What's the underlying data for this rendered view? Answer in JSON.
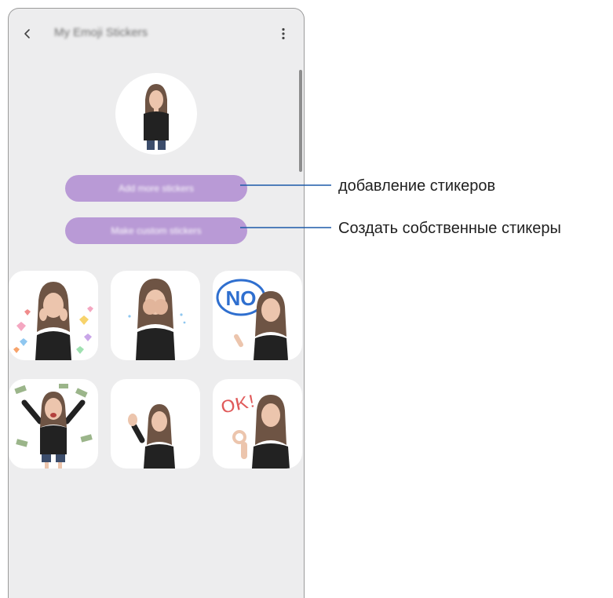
{
  "app": {
    "title": "My Emoji Stickers",
    "back_icon": "chevron-left-icon",
    "more_icon": "more-vertical-icon"
  },
  "buttons": {
    "add_label": "Add more stickers",
    "custom_label": "Make custom stickers",
    "color": "#b99ad6"
  },
  "stickers": [
    {
      "name": "hearts-surprised"
    },
    {
      "name": "face-palm"
    },
    {
      "name": "no-speech-bubble",
      "text": "NO"
    },
    {
      "name": "money-rain-celebrate"
    },
    {
      "name": "wave-hello"
    },
    {
      "name": "ok-gesture",
      "text": "OK!"
    }
  ],
  "callouts": {
    "add": "добавление стикеров",
    "custom": "Создать собственные стикеры"
  }
}
